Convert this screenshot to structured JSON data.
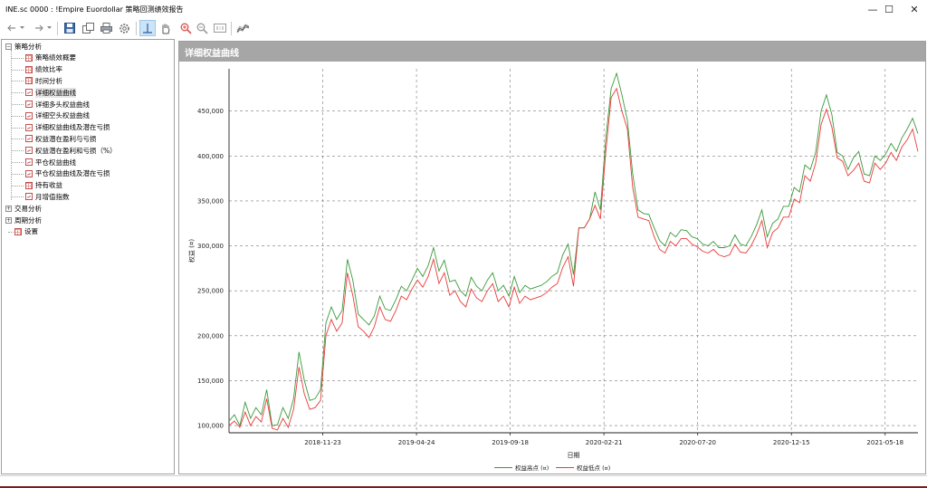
{
  "window": {
    "title": "INE.sc 0000 : !Empire Euordollar 策略回测绩效报告",
    "minimize_label": "—",
    "maximize_label": "☐",
    "close_label": "✕"
  },
  "toolbar": {
    "icons": [
      "back-arrow-icon",
      "forward-arrow-icon",
      "save-icon",
      "copy-icon",
      "print-icon",
      "settings-icon",
      "crosshair-icon",
      "hand-icon",
      "zoom-in-icon",
      "zoom-out-icon",
      "zoom-reset-icon",
      "chart-type-icon"
    ]
  },
  "tree": {
    "nodes": [
      {
        "label": "策略分析",
        "level": 0,
        "expanded": true
      },
      {
        "label": "策略绩效概要",
        "level": 1,
        "icon": "grid"
      },
      {
        "label": "绩效比率",
        "level": 1,
        "icon": "grid"
      },
      {
        "label": "时间分析",
        "level": 1,
        "icon": "grid"
      },
      {
        "label": "详细权益曲线",
        "level": 1,
        "icon": "line",
        "selected": true
      },
      {
        "label": "详细多头权益曲线",
        "level": 1,
        "icon": "line"
      },
      {
        "label": "详细空头权益曲线",
        "level": 1,
        "icon": "line"
      },
      {
        "label": "详细权益曲线及潜在亏损",
        "level": 1,
        "icon": "line"
      },
      {
        "label": "权益潜在盈利与亏损",
        "level": 1,
        "icon": "line"
      },
      {
        "label": "权益潜在盈利和亏损（%）",
        "level": 1,
        "icon": "line"
      },
      {
        "label": "平仓权益曲线",
        "level": 1,
        "icon": "line"
      },
      {
        "label": "平仓权益曲线及潜在亏损",
        "level": 1,
        "icon": "line"
      },
      {
        "label": "持有收益",
        "level": 1,
        "icon": "grid"
      },
      {
        "label": "月增值指数",
        "level": 1,
        "icon": "line"
      },
      {
        "label": "交易分析",
        "level": 0,
        "expanded": false
      },
      {
        "label": "周期分析",
        "level": 0,
        "expanded": false
      },
      {
        "label": "设置",
        "level": 0,
        "icon": "grid"
      }
    ]
  },
  "panel": {
    "title": "详细权益曲线"
  },
  "chart_data": {
    "type": "line",
    "xlabel": "日期",
    "ylabel": "权益 (¤)",
    "ylim": [
      92000,
      497000
    ],
    "yticks": [
      100000,
      150000,
      200000,
      250000,
      300000,
      350000,
      400000,
      450000
    ],
    "ytick_labels": [
      "100,000",
      "150,000",
      "200,000",
      "250,000",
      "300,000",
      "350,000",
      "400,000",
      "450,000"
    ],
    "xtick_labels": [
      "2018-11-23",
      "2019-04-24",
      "2019-09-18",
      "2020-02-21",
      "2020-07-20",
      "2020-12-15",
      "2021-05-18"
    ],
    "grid": true,
    "legend_position": "bottom",
    "series": [
      {
        "name": "权益高点 (¤)",
        "color": "#3a9a3a",
        "values": [
          105000,
          112000,
          100000,
          126000,
          108000,
          120000,
          112000,
          140000,
          100000,
          101000,
          120000,
          108000,
          130000,
          182000,
          150000,
          128000,
          130000,
          140000,
          214000,
          232000,
          218000,
          228000,
          285000,
          262000,
          224000,
          218000,
          212000,
          222000,
          244000,
          230000,
          228000,
          240000,
          255000,
          250000,
          262000,
          275000,
          266000,
          278000,
          298000,
          272000,
          284000,
          260000,
          262000,
          250000,
          244000,
          265000,
          255000,
          250000,
          262000,
          270000,
          250000,
          256000,
          244000,
          266000,
          248000,
          256000,
          252000,
          254000,
          256000,
          260000,
          266000,
          270000,
          290000,
          302000,
          268000,
          320000,
          320000,
          330000,
          360000,
          340000,
          420000,
          475000,
          492000,
          468000,
          440000,
          380000,
          340000,
          336000,
          335000,
          320000,
          306000,
          300000,
          315000,
          310000,
          318000,
          317000,
          310000,
          308000,
          302000,
          300000,
          305000,
          298000,
          298000,
          300000,
          312000,
          302000,
          300000,
          310000,
          323000,
          340000,
          310000,
          325000,
          330000,
          344000,
          344000,
          365000,
          360000,
          390000,
          385000,
          404000,
          450000,
          468000,
          446000,
          404000,
          400000,
          385000,
          398000,
          405000,
          380000,
          378000,
          400000,
          395000,
          402000,
          414000,
          405000,
          420000,
          430000,
          442000,
          425000
        ]
      },
      {
        "name": "权益低点 (¤)",
        "color": "#e83a3a",
        "values": [
          100000,
          105000,
          98000,
          115000,
          100000,
          110000,
          104000,
          130000,
          97000,
          95000,
          108000,
          98000,
          118000,
          165000,
          135000,
          118000,
          120000,
          128000,
          200000,
          218000,
          205000,
          214000,
          270000,
          245000,
          210000,
          205000,
          198000,
          210000,
          232000,
          218000,
          216000,
          228000,
          244000,
          240000,
          252000,
          262000,
          254000,
          266000,
          285000,
          258000,
          270000,
          245000,
          250000,
          238000,
          232000,
          252000,
          242000,
          238000,
          250000,
          258000,
          238000,
          244000,
          232000,
          254000,
          236000,
          244000,
          240000,
          242000,
          244000,
          248000,
          254000,
          258000,
          276000,
          288000,
          255000,
          320000,
          320000,
          330000,
          345000,
          330000,
          405000,
          465000,
          475000,
          450000,
          430000,
          365000,
          332000,
          330000,
          328000,
          310000,
          296000,
          292000,
          305000,
          300000,
          308000,
          308000,
          302000,
          299000,
          294000,
          292000,
          296000,
          290000,
          288000,
          290000,
          302000,
          293000,
          292000,
          300000,
          312000,
          328000,
          298000,
          315000,
          320000,
          332000,
          332000,
          352000,
          348000,
          378000,
          372000,
          392000,
          435000,
          452000,
          432000,
          398000,
          394000,
          378000,
          384000,
          392000,
          372000,
          370000,
          392000,
          385000,
          392000,
          404000,
          395000,
          410000,
          418000,
          430000,
          405000
        ]
      }
    ]
  }
}
